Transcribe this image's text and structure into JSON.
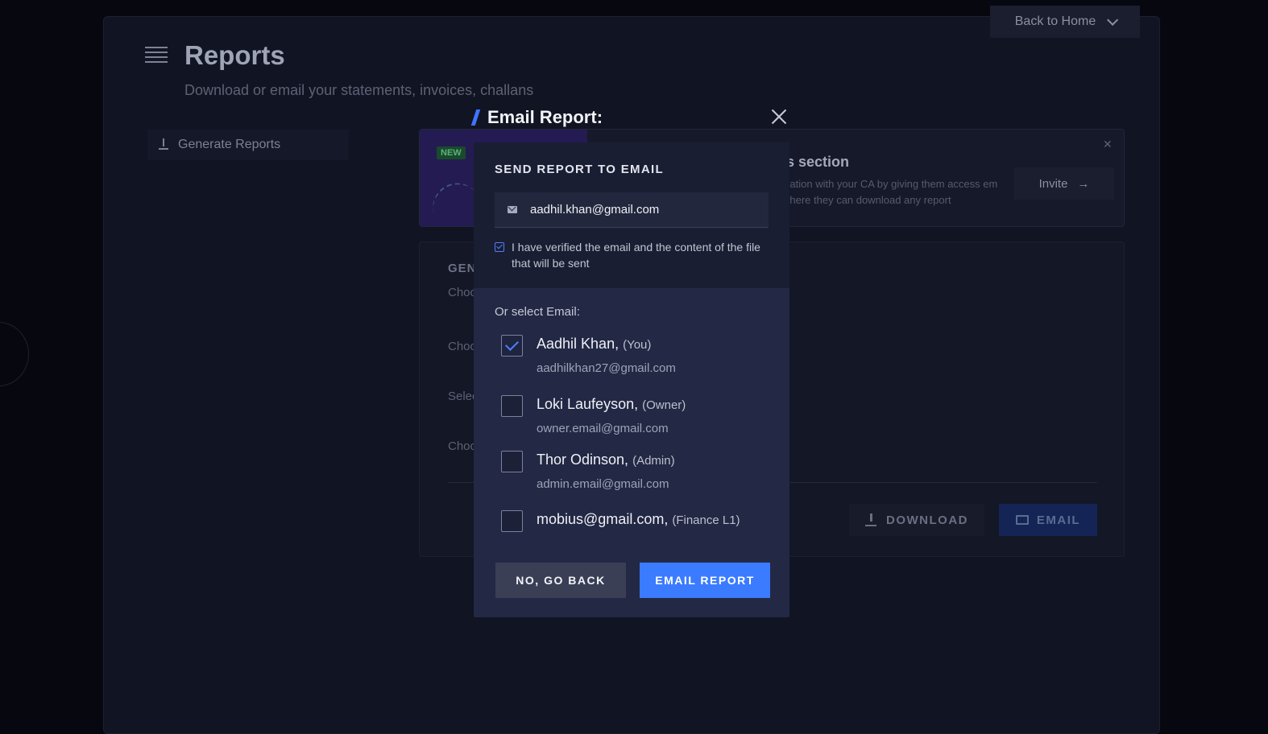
{
  "background": {
    "back_home_label": "Back to Home",
    "page_title": "Reports",
    "page_subtitle": "Download or email your statements, invoices, challans",
    "sidebar_item": "Generate Reports",
    "promo": {
      "badge": "NEW",
      "title": "is section",
      "text": "ication with your CA by giving them access em where they can download any report",
      "invite_label": "Invite"
    },
    "generate": {
      "title": "GEN",
      "labels": [
        "Choo",
        "Choo",
        "Selec",
        "Choo"
      ],
      "download_label": "DOWNLOAD",
      "email_label": "EMAIL"
    }
  },
  "modal": {
    "title": "Email Report:",
    "send_title": "SEND REPORT TO EMAIL",
    "email_value": "aadhil.khan@gmail.com",
    "verify_text": "I have verified the email and the content of the file that will be sent",
    "select_title": "Or select Email:",
    "options": [
      {
        "name": "Aadhil Khan,",
        "role": "(You)",
        "email": "aadhilkhan27@gmail.com",
        "checked": true
      },
      {
        "name": "Loki Laufeyson,",
        "role": "(Owner)",
        "email": "owner.email@gmail.com",
        "checked": false
      },
      {
        "name": "Thor Odinson,",
        "role": "(Admin)",
        "email": "admin.email@gmail.com",
        "checked": false
      },
      {
        "name": "mobius@gmail.com,",
        "role": "(Finance L1)",
        "email": "",
        "checked": false
      }
    ],
    "back_label": "NO, GO BACK",
    "submit_label": "EMAIL REPORT"
  },
  "colors": {
    "accent": "#3b7bff",
    "modal_bg": "#232844",
    "modal_top_bg": "#1a1e33",
    "page_bg": "#07080f"
  }
}
